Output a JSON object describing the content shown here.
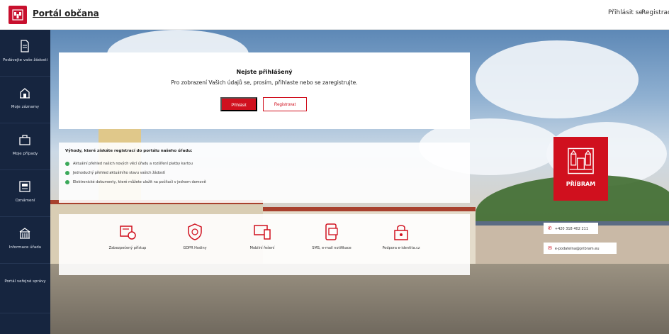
{
  "header": {
    "site_title": "Portál občana",
    "login_link": "Přihlásit se",
    "register_link": "Registrace",
    "logo_icon": "city-crest-icon",
    "accent": "#c8102e"
  },
  "sidebar": {
    "items": [
      {
        "label": "Podávejte vaše žádosti",
        "icon": "document-icon"
      },
      {
        "label": "Moje záznamy",
        "icon": "building-icon"
      },
      {
        "label": "Moje případy",
        "icon": "briefcase-icon"
      },
      {
        "label": "Oznámení",
        "icon": "notice-icon"
      },
      {
        "label": "Informace úřadu",
        "icon": "townhall-icon"
      },
      {
        "label": "Portál veřejné správy",
        "icon": ""
      }
    ]
  },
  "login_card": {
    "title": "Nejste přihlášený",
    "subtitle": "Pro zobrazení Vašich údajů se, prosím, přihlaste nebo se zaregistrujte.",
    "login_button": "Přihlásit",
    "register_button": "Registrovat"
  },
  "benefits": {
    "title": "Výhody, které získáte registrací do portálu našeho úřadu:",
    "items": [
      "Aktuální přehled našich nových věcí úřadu a rozšíření platby kartou",
      "Jednoduchý přehled aktuálního stavu vašich žádostí",
      "Elektronické dokumenty, které můžete uložit na počítači v jednom domově"
    ]
  },
  "features": {
    "items": [
      {
        "label": "Zabezpečený přístup",
        "icon": "secure-access-icon"
      },
      {
        "label": "GDPR Hodiny",
        "icon": "gdpr-shield-icon"
      },
      {
        "label": "Mobilní řešení",
        "icon": "devices-icon"
      },
      {
        "label": "SMS, e-mail notifikace",
        "icon": "notification-icon"
      },
      {
        "label": "Podpora e-identita.cz",
        "icon": "eidentity-lock-icon"
      }
    ]
  },
  "city_badge": {
    "name": "PŘÍBRAM",
    "phone": "+420 318 402 211",
    "email": "e-podatelna@pribram.eu"
  }
}
